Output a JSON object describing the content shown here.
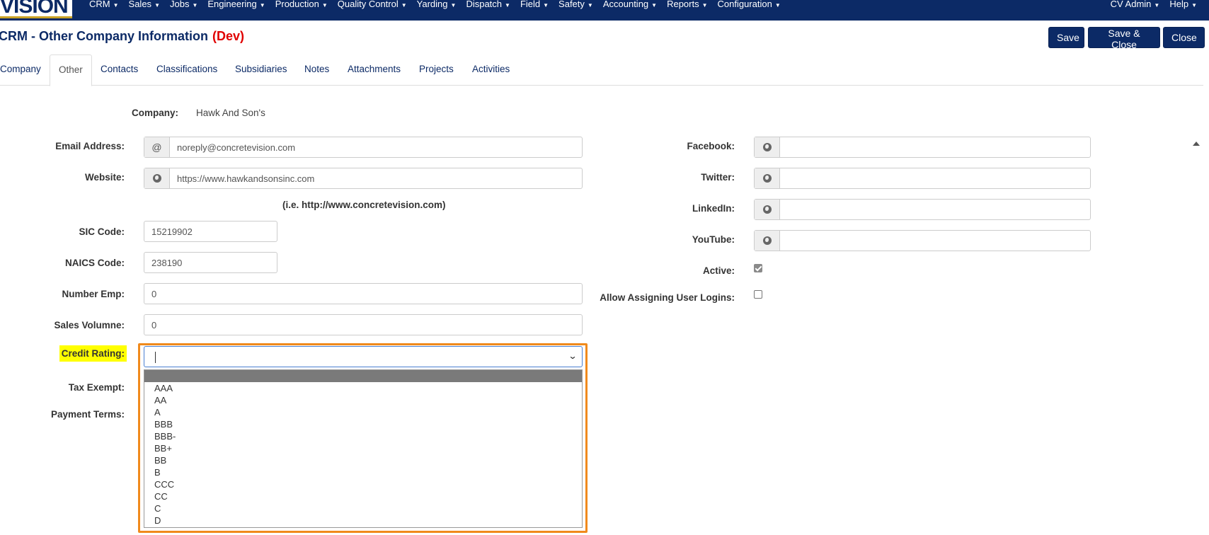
{
  "nav": {
    "logo": "VISION",
    "menu": [
      "CRM",
      "Sales",
      "Jobs",
      "Engineering",
      "Production",
      "Quality Control",
      "Yarding",
      "Dispatch",
      "Field",
      "Safety",
      "Accounting",
      "Reports",
      "Configuration"
    ],
    "right": [
      "CV Admin",
      "Help"
    ]
  },
  "header": {
    "title": "CRM - Other Company Information",
    "env": "(Dev)",
    "save": "Save",
    "save_close": "Save & Close",
    "close": "Close"
  },
  "tabs": [
    "Company",
    "Other",
    "Contacts",
    "Classifications",
    "Subsidiaries",
    "Notes",
    "Attachments",
    "Projects",
    "Activities"
  ],
  "active_tab": "Other",
  "form": {
    "company_label": "Company:",
    "company_value": "Hawk And Son's",
    "email_label": "Email Address:",
    "email_addon": "@",
    "email_value": "noreply@concretevision.com",
    "website_label": "Website:",
    "website_value": "https://www.hawkandsonsinc.com",
    "website_hint": "(i.e. http://www.concretevision.com)",
    "sic_label": "SIC Code:",
    "sic_value": "15219902",
    "naics_label": "NAICS Code:",
    "naics_value": "238190",
    "num_emp_label": "Number Emp:",
    "num_emp_value": "0",
    "sales_volume_label": "Sales Volumne:",
    "sales_volume_value": "0",
    "credit_rating_label": "Credit Rating:",
    "tax_exempt_label": "Tax Exempt:",
    "payment_terms_label": "Payment Terms:",
    "facebook_label": "Facebook:",
    "twitter_label": "Twitter:",
    "linkedin_label": "LinkedIn:",
    "youtube_label": "YouTube:",
    "active_label": "Active:",
    "active_checked": true,
    "allow_logins_label": "Allow Assigning User Logins:",
    "allow_logins_checked": false
  },
  "credit_rating_options": [
    "AAA",
    "AA",
    "A",
    "BBB",
    "BBB-",
    "BB+",
    "BB",
    "B",
    "CCC",
    "CC",
    "C",
    "D"
  ],
  "colors": {
    "nav_bg": "#0c2a66",
    "dev_red": "#e00000",
    "highlight": "#ffff00",
    "focus_outline": "#f08a1c"
  }
}
